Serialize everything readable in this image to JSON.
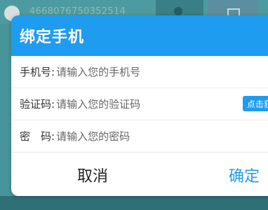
{
  "background": {
    "user_id": "4668076750352514"
  },
  "dialog": {
    "title": "绑定手机",
    "phone_label": "手机号:",
    "phone_placeholder": "请输入您的手机号",
    "code_label": "验证码:",
    "code_placeholder": "请输入您的验证码",
    "get_code_label": "点击获取",
    "password_label": "密　码:",
    "password_placeholder": "请输入您的密码",
    "cancel_label": "取消",
    "confirm_label": "确定"
  },
  "colors": {
    "accent": "#1e9cf0",
    "backdrop": "#3f8f95"
  }
}
